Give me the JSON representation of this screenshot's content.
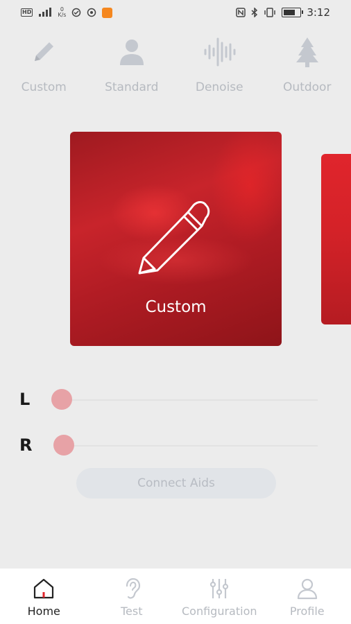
{
  "status_bar": {
    "left_icons": [
      "hd-icon",
      "signal-icon",
      "data-speed-icon",
      "vpn-icon",
      "target-icon",
      "app-notification-icon"
    ],
    "speed_top": "0",
    "speed_bottom": "K/s",
    "hd": "HD",
    "right_icons": [
      "nfc-icon",
      "bluetooth-icon",
      "vibrate-icon",
      "battery-icon"
    ],
    "time": "3:12"
  },
  "modes": [
    {
      "label": "Custom",
      "icon": "pencil-icon"
    },
    {
      "label": "Standard",
      "icon": "person-icon"
    },
    {
      "label": "Denoise",
      "icon": "waveform-icon"
    },
    {
      "label": "Outdoor",
      "icon": "tree-icon"
    }
  ],
  "carousel": {
    "current_title": "Custom",
    "current_icon": "pencil-icon",
    "accent_color": "#c8242b"
  },
  "sliders": [
    {
      "label": "L",
      "value": 0
    },
    {
      "label": "R",
      "value": 0
    }
  ],
  "connect_button": "Connect Aids",
  "bottom_nav": [
    {
      "label": "Home",
      "icon": "home-icon",
      "active": true
    },
    {
      "label": "Test",
      "icon": "ear-icon",
      "active": false
    },
    {
      "label": "Configuration",
      "icon": "equalizer-icon",
      "active": false
    },
    {
      "label": "Profile",
      "icon": "user-icon",
      "active": false
    }
  ],
  "colors": {
    "inactive_text": "#b6bac0",
    "active_nav_accent": "#e0252c",
    "slider_thumb": "#e7a2a6"
  }
}
